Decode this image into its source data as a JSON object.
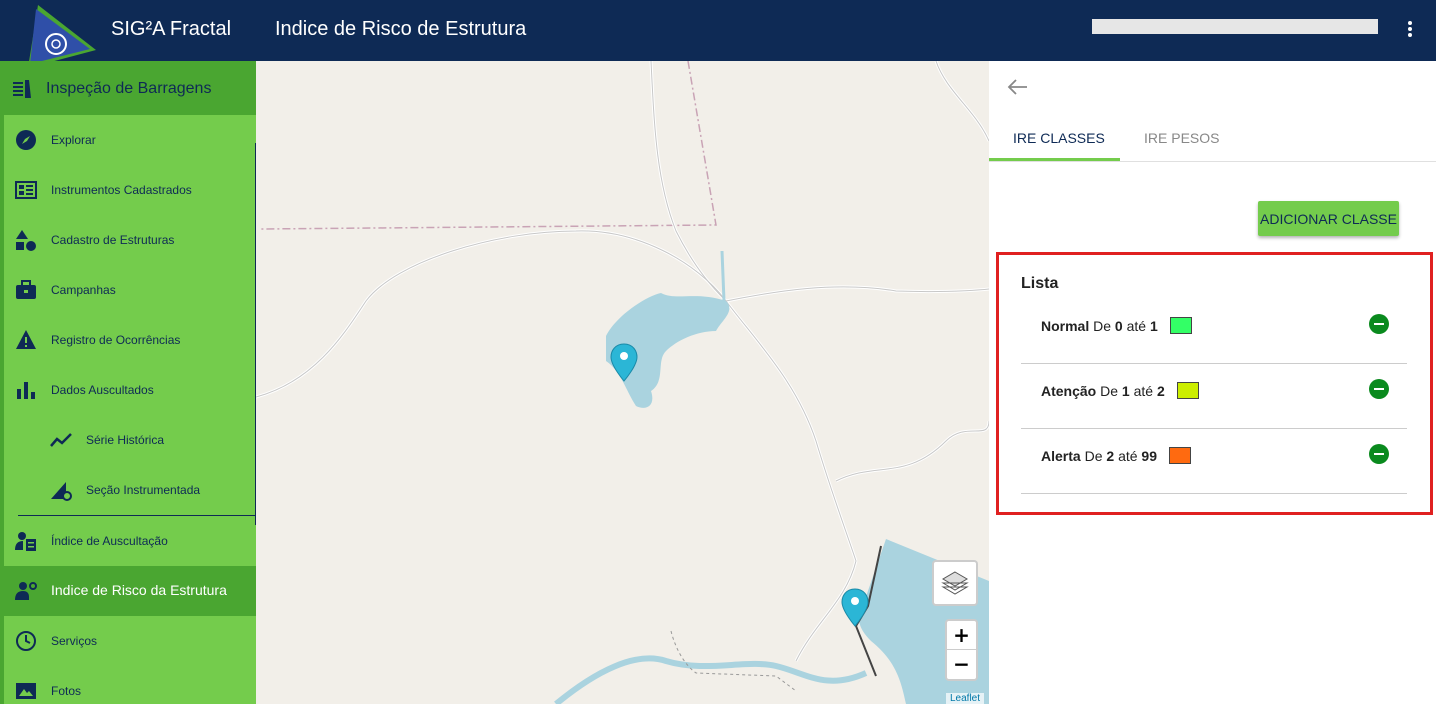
{
  "header": {
    "app_name": "SIG²A Fractal",
    "page_title": "Indice de Risco de Estrutura"
  },
  "sidebar": {
    "module_title": "Inspeção de Barragens",
    "items": [
      {
        "label": "Explorar",
        "icon": "compass-icon"
      },
      {
        "label": "Instrumentos Cadastrados",
        "icon": "dashboard-icon"
      },
      {
        "label": "Cadastro de Estruturas",
        "icon": "shapes-icon"
      },
      {
        "label": "Campanhas",
        "icon": "briefcase-icon"
      },
      {
        "label": "Registro de Ocorrências",
        "icon": "warning-icon"
      },
      {
        "label": "Dados Auscultados",
        "icon": "bar-chart-icon"
      },
      {
        "label": "Série Histórica",
        "icon": "line-chart-icon"
      },
      {
        "label": "Seção Instrumentada",
        "icon": "section-gear-icon"
      },
      {
        "label": "Índice de Auscultação",
        "icon": "user-clipboard-icon"
      },
      {
        "label": "Indice de Risco da Estrutura",
        "icon": "user-gear-icon"
      },
      {
        "label": "Serviços",
        "icon": "clock-icon"
      },
      {
        "label": "Fotos",
        "icon": "image-icon"
      }
    ]
  },
  "map": {
    "zoom_in": "+",
    "zoom_out": "−",
    "attribution": "Leaflet",
    "colors": {
      "land": "#f2efe9",
      "water": "#aad3df",
      "marker": "#2bb6d6"
    }
  },
  "panel": {
    "tabs": [
      "IRE CLASSES",
      "IRE PESOS"
    ],
    "add_button": "ADICIONAR CLASSE",
    "list_title": "Lista",
    "classes": [
      {
        "name": "Normal",
        "de": "De",
        "from": "0",
        "ate": "até",
        "to": "1",
        "color": "#33ff66"
      },
      {
        "name": "Atenção",
        "de": "De",
        "from": "1",
        "ate": "até",
        "to": "2",
        "color": "#ccee00"
      },
      {
        "name": "Alerta",
        "de": "De",
        "from": "2",
        "ate": "até",
        "to": "99",
        "color": "#ff6a10"
      }
    ]
  }
}
